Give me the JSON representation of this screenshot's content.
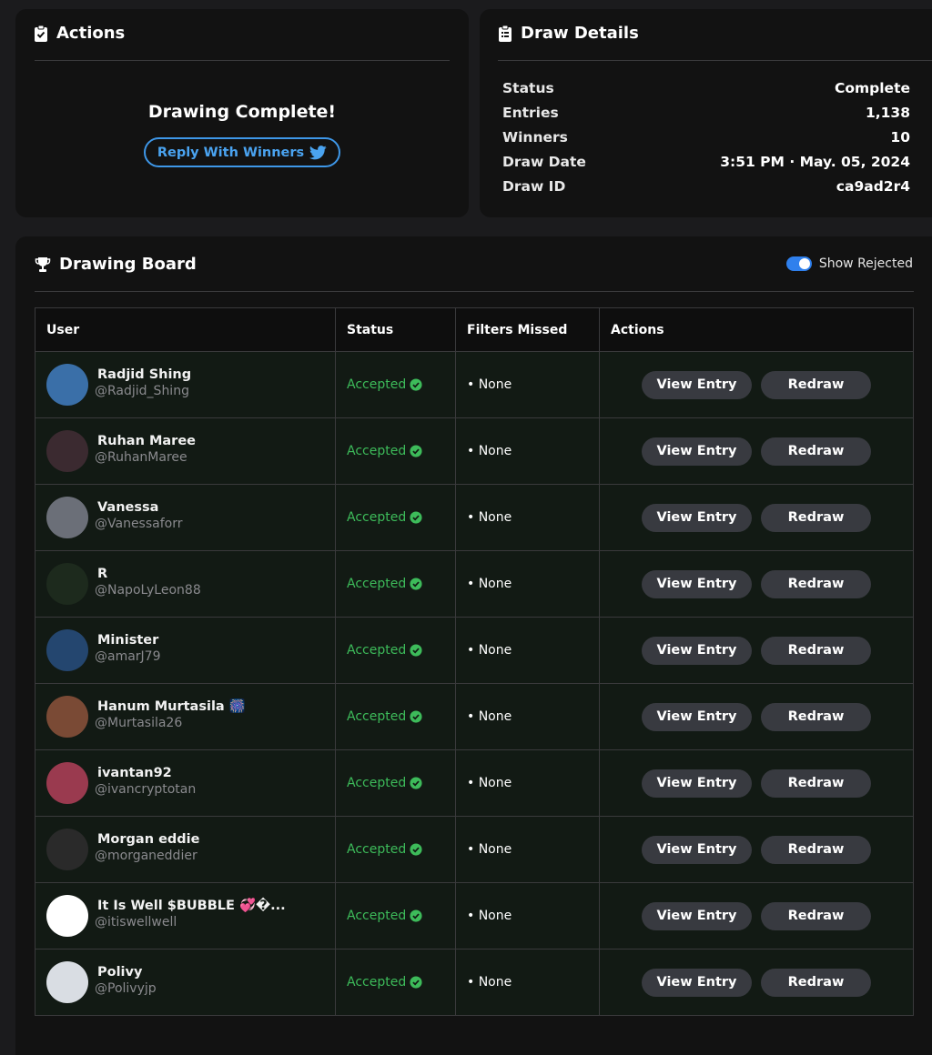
{
  "actions_panel": {
    "title": "Actions",
    "message": "Drawing Complete!",
    "reply_button": "Reply With Winners"
  },
  "details_panel": {
    "title": "Draw Details",
    "rows": [
      {
        "label": "Status",
        "value": "Complete"
      },
      {
        "label": "Entries",
        "value": "1,138"
      },
      {
        "label": "Winners",
        "value": "10"
      },
      {
        "label": "Draw Date",
        "value": "3:51 PM · May. 05, 2024"
      },
      {
        "label": "Draw ID",
        "value": "ca9ad2r4"
      }
    ]
  },
  "board": {
    "title": "Drawing Board",
    "toggle_label": "Show Rejected",
    "toggle_on": true,
    "columns": [
      "User",
      "Status",
      "Filters Missed",
      "Actions"
    ],
    "view_label": "View Entry",
    "redraw_label": "Redraw",
    "rows": [
      {
        "name": "Radjid Shing",
        "handle": "@Radjid_Shing",
        "status": "Accepted",
        "filters": "• None",
        "avatar_color": "#3a6fa8"
      },
      {
        "name": "Ruhan Maree",
        "handle": "@RuhanMaree",
        "status": "Accepted",
        "filters": "• None",
        "avatar_color": "#3b2a30"
      },
      {
        "name": "Vanessa",
        "handle": "@Vanessaforr",
        "status": "Accepted",
        "filters": "• None",
        "avatar_color": "#6b6f78"
      },
      {
        "name": "R",
        "handle": "@NapoLyLeon88",
        "status": "Accepted",
        "filters": "• None",
        "avatar_color": "#1d2a1d"
      },
      {
        "name": "Minister",
        "handle": "@amarJ79",
        "status": "Accepted",
        "filters": "• None",
        "avatar_color": "#24466f"
      },
      {
        "name": "Hanum Murtasila 🎆",
        "handle": "@Murtasila26",
        "status": "Accepted",
        "filters": "• None",
        "avatar_color": "#7a4a35"
      },
      {
        "name": "ivantan92",
        "handle": "@ivancryptotan",
        "status": "Accepted",
        "filters": "• None",
        "avatar_color": "#9a3a4f"
      },
      {
        "name": "Morgan eddie",
        "handle": "@morganeddier",
        "status": "Accepted",
        "filters": "• None",
        "avatar_color": "#2a2a2a"
      },
      {
        "name": "It Is Well $BUBBLE 💞�...",
        "handle": "@itiswellwell",
        "status": "Accepted",
        "filters": "• None",
        "avatar_color": "#ffffff"
      },
      {
        "name": "Polivy",
        "handle": "@Polivyjp",
        "status": "Accepted",
        "filters": "• None",
        "avatar_color": "#d9dde3"
      }
    ]
  },
  "colors": {
    "accent_blue": "#3e97e8",
    "accepted_green": "#3dbb5a",
    "toggle_blue": "#2f80ed"
  }
}
